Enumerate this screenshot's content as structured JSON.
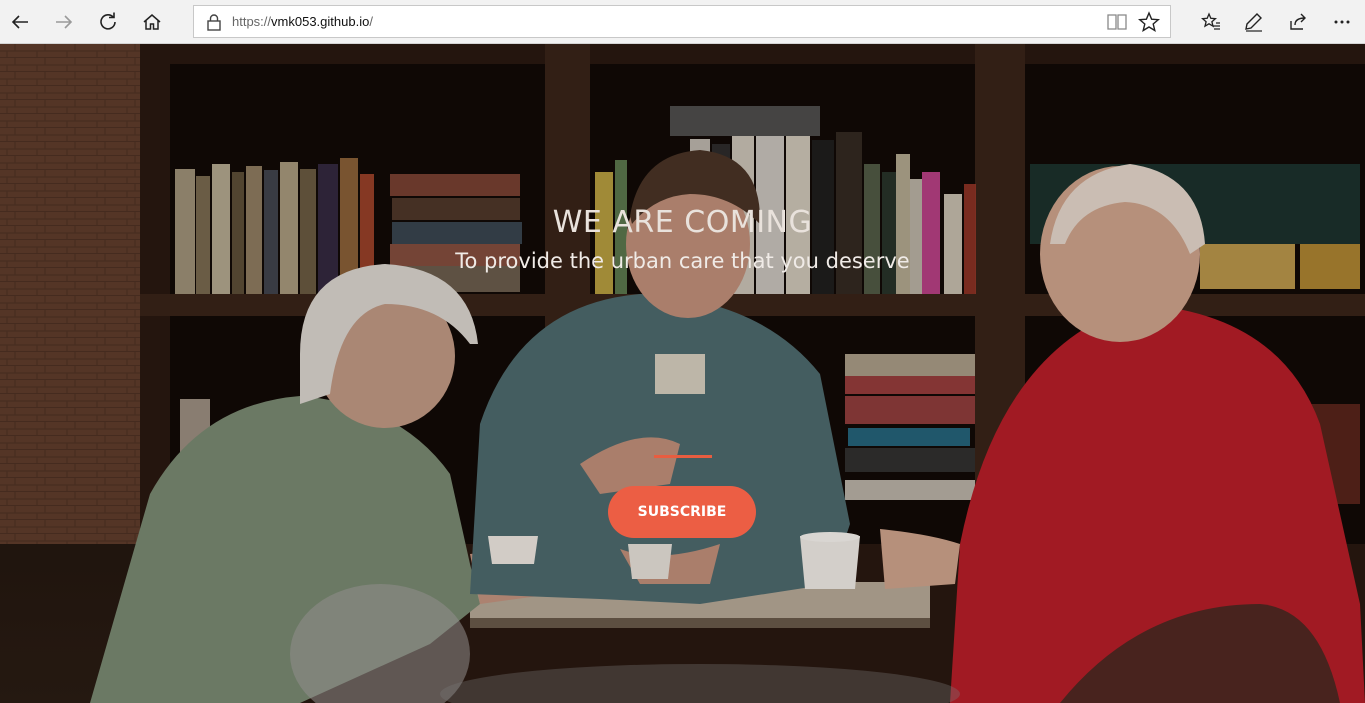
{
  "browser": {
    "url_prefix": "https://",
    "url_host": "vmk053.github.io",
    "url_suffix": "/",
    "icons": {
      "back": "back-arrow-icon",
      "forward": "forward-arrow-icon",
      "refresh": "refresh-icon",
      "home": "home-icon",
      "lock": "lock-icon",
      "reading_view": "reading-view-icon",
      "favorite": "favorite-star-icon",
      "favorites_hub": "favorites-list-icon",
      "notes": "pen-icon",
      "share": "share-icon",
      "more": "more-icon"
    }
  },
  "hero": {
    "headline": "WE ARE COMING",
    "subline": "To provide the urban care that you deserve",
    "subscribe_label": "Subscribe",
    "accent_color": "#ec5e44"
  }
}
